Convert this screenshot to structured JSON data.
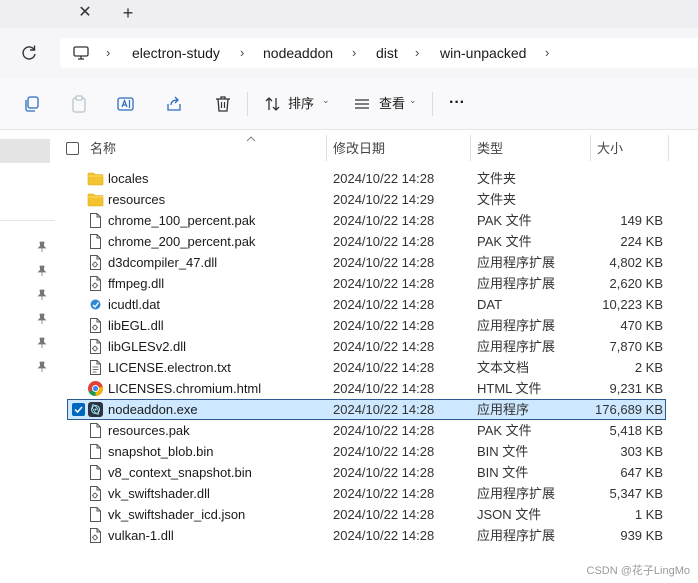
{
  "tabbar": {
    "close_glyph": "✕",
    "new_tab_glyph": "+"
  },
  "address": {
    "crumbs": [
      "electron-study",
      "nodeaddon",
      "dist",
      "win-unpacked"
    ],
    "separator": "›"
  },
  "toolbar": {
    "sort_label": "排序",
    "view_label": "查看",
    "more_label": "···",
    "caret": "⌄"
  },
  "columns": {
    "name": "名称",
    "date": "修改日期",
    "type": "类型",
    "size": "大小"
  },
  "colors": {
    "folder": "#f4c430",
    "selection": "#cde8ff",
    "accent": "#0067c0"
  },
  "files": [
    {
      "name": "locales",
      "date": "2024/10/22 14:28",
      "type": "文件夹",
      "size": "",
      "icon": "folder-icon"
    },
    {
      "name": "resources",
      "date": "2024/10/22 14:29",
      "type": "文件夹",
      "size": "",
      "icon": "folder-icon"
    },
    {
      "name": "chrome_100_percent.pak",
      "date": "2024/10/22 14:28",
      "type": "PAK 文件",
      "size": "149 KB",
      "icon": "file-icon"
    },
    {
      "name": "chrome_200_percent.pak",
      "date": "2024/10/22 14:28",
      "type": "PAK 文件",
      "size": "224 KB",
      "icon": "file-icon"
    },
    {
      "name": "d3dcompiler_47.dll",
      "date": "2024/10/22 14:28",
      "type": "应用程序扩展",
      "size": "4,802 KB",
      "icon": "dll-icon"
    },
    {
      "name": "ffmpeg.dll",
      "date": "2024/10/22 14:28",
      "type": "应用程序扩展",
      "size": "2,620 KB",
      "icon": "dll-icon"
    },
    {
      "name": "icudtl.dat",
      "date": "2024/10/22 14:28",
      "type": "DAT",
      "size": "10,223 KB",
      "icon": "dat-icon"
    },
    {
      "name": "libEGL.dll",
      "date": "2024/10/22 14:28",
      "type": "应用程序扩展",
      "size": "470 KB",
      "icon": "dll-icon"
    },
    {
      "name": "libGLESv2.dll",
      "date": "2024/10/22 14:28",
      "type": "应用程序扩展",
      "size": "7,870 KB",
      "icon": "dll-icon"
    },
    {
      "name": "LICENSE.electron.txt",
      "date": "2024/10/22 14:28",
      "type": "文本文档",
      "size": "2 KB",
      "icon": "text-file-icon"
    },
    {
      "name": "LICENSES.chromium.html",
      "date": "2024/10/22 14:28",
      "type": "HTML 文件",
      "size": "9,231 KB",
      "icon": "chrome-icon"
    },
    {
      "name": "nodeaddon.exe",
      "date": "2024/10/22 14:28",
      "type": "应用程序",
      "size": "176,689 KB",
      "icon": "exe-icon",
      "selected": true
    },
    {
      "name": "resources.pak",
      "date": "2024/10/22 14:28",
      "type": "PAK 文件",
      "size": "5,418 KB",
      "icon": "file-icon"
    },
    {
      "name": "snapshot_blob.bin",
      "date": "2024/10/22 14:28",
      "type": "BIN 文件",
      "size": "303 KB",
      "icon": "file-icon"
    },
    {
      "name": "v8_context_snapshot.bin",
      "date": "2024/10/22 14:28",
      "type": "BIN 文件",
      "size": "647 KB",
      "icon": "file-icon"
    },
    {
      "name": "vk_swiftshader.dll",
      "date": "2024/10/22 14:28",
      "type": "应用程序扩展",
      "size": "5,347 KB",
      "icon": "dll-icon"
    },
    {
      "name": "vk_swiftshader_icd.json",
      "date": "2024/10/22 14:28",
      "type": "JSON 文件",
      "size": "1 KB",
      "icon": "file-icon"
    },
    {
      "name": "vulkan-1.dll",
      "date": "2024/10/22 14:28",
      "type": "应用程序扩展",
      "size": "939 KB",
      "icon": "dll-icon"
    }
  ],
  "watermark": "CSDN @花子LingMo"
}
